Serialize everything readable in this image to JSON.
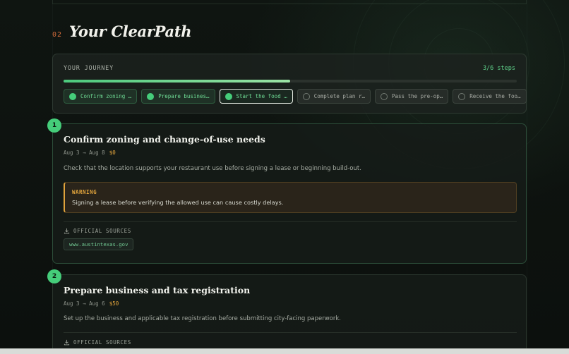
{
  "hero": {
    "number": "02",
    "title": "Your ClearPath"
  },
  "journey": {
    "label": "YOUR JOURNEY",
    "count": "3/6 steps",
    "progress_fraction": 0.5,
    "steps": [
      {
        "label": "Confirm zoning …",
        "state": "done"
      },
      {
        "label": "Prepare busines…",
        "state": "done"
      },
      {
        "label": "Start the food …",
        "state": "current"
      },
      {
        "label": "Complete plan r…",
        "state": "todo"
      },
      {
        "label": "Pass the pre-op…",
        "state": "todo"
      },
      {
        "label": "Receive the foo…",
        "state": "todo"
      }
    ]
  },
  "steps": [
    {
      "number": "1",
      "title": "Confirm zoning and change-of-use needs",
      "dates": "Aug 3 → Aug 8",
      "cost": "$0",
      "description": "Check that the location supports your restaurant use before signing a lease or beginning build-out.",
      "warning": {
        "label": "WARNING",
        "text": "Signing a lease before verifying the allowed use can cause costly delays."
      },
      "sources_label": "OFFICIAL SOURCES",
      "sources": [
        "www.austintexas.gov"
      ]
    },
    {
      "number": "2",
      "title": "Prepare business and tax registration",
      "dates": "Aug 3 → Aug 6",
      "cost": "$50",
      "description": "Set up the business and applicable tax registration before submitting city-facing paperwork.",
      "sources_label": "OFFICIAL SOURCES"
    }
  ],
  "colors": {
    "accent": "#45cd7a",
    "warning": "#e0a33c",
    "hero_number": "#d06a3a"
  }
}
